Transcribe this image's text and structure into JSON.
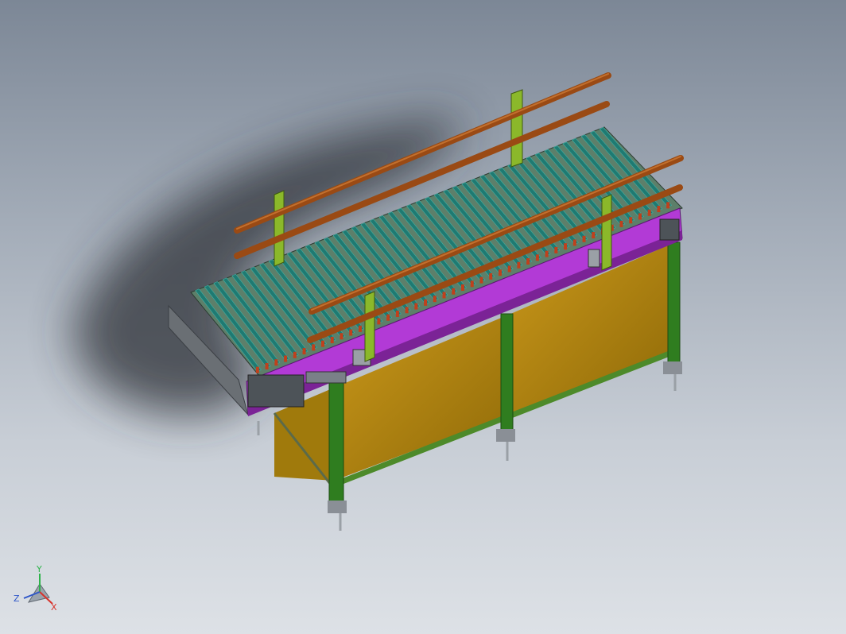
{
  "viewport": {
    "background_top": "#7c8796",
    "background_bottom": "#dde1e6"
  },
  "model": {
    "subject": "roller-conveyor-assembly",
    "roller_count": 45,
    "colors": {
      "rollers": "#1f7a72",
      "roller_edge": "#3fb0a4",
      "side_frame": "#b23ad6",
      "side_frame_dark": "#6d1f86",
      "legs": "#2f7d1f",
      "panels": "#b88a10",
      "guard_rails": "#9a4a14",
      "brackets": "#8bb82a",
      "shadow": "#3b3f44"
    }
  },
  "triad": {
    "x_label": "X",
    "y_label": "Y",
    "z_label": "Z",
    "x_color": "#d8322a",
    "y_color": "#2db34a",
    "z_color": "#2d56c8"
  }
}
